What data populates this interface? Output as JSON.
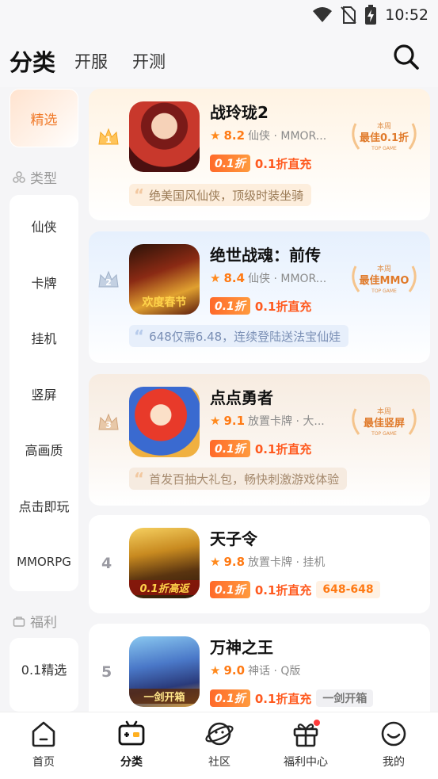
{
  "status_bar": {
    "time": "10:52"
  },
  "header": {
    "tabs": [
      {
        "label": "分类"
      },
      {
        "label": "开服"
      },
      {
        "label": "开测"
      }
    ]
  },
  "sidebar": {
    "selected": "精选",
    "type_section": {
      "title": "类型",
      "items": [
        "仙侠",
        "卡牌",
        "挂机",
        "竖屏",
        "高画质",
        "点击即玩",
        "MMORPG"
      ]
    },
    "welfare_section": {
      "title": "福利",
      "items": [
        "0.1精选"
      ]
    }
  },
  "games": [
    {
      "rank": "1",
      "title": "战玲珑2",
      "score": "8.2",
      "meta": "仙侠 · MMOR...",
      "discount_badge": "0.1折",
      "discount_text": "0.1折直充",
      "award_top": "本周",
      "award_main": "最佳0.1折",
      "award_sub": "TOP GAME",
      "slogan": "绝美国风仙侠，顶级时装坐骑"
    },
    {
      "rank": "2",
      "title": "绝世战魂：前传",
      "score": "8.4",
      "meta": "仙侠 · MMOR...",
      "discount_badge": "0.1折",
      "discount_text": "0.1折直充",
      "award_top": "本周",
      "award_main": "最佳MMO",
      "award_sub": "TOP GAME",
      "icon_caption": "欢度春节",
      "slogan": "648仅需6.48，连续登陆送法宝仙娃"
    },
    {
      "rank": "3",
      "title": "点点勇者",
      "score": "9.1",
      "meta": "放置卡牌 · 大...",
      "discount_badge": "0.1折",
      "discount_text": "0.1折直充",
      "award_top": "本周",
      "award_main": "最佳竖屏",
      "award_sub": "TOP GAME",
      "slogan": "首发百抽大礼包，畅快刺激游戏体验"
    },
    {
      "rank": "4",
      "title": "天子令",
      "score": "9.8",
      "meta": "放置卡牌 · 挂机",
      "discount_badge": "0.1折",
      "discount_text": "0.1折直充",
      "extra_tag": "648-648",
      "icon_caption": "0.1折高返"
    },
    {
      "rank": "5",
      "title": "万神之王",
      "score": "9.0",
      "meta": "神话 · Q版",
      "discount_badge": "0.1折",
      "discount_text": "0.1折直充",
      "extra_tag": "一剑开箱",
      "icon_caption": "一剑开箱"
    }
  ],
  "bottom_nav": [
    {
      "label": "首页",
      "icon": "home-icon"
    },
    {
      "label": "分类",
      "icon": "category-icon",
      "active": true
    },
    {
      "label": "社区",
      "icon": "community-icon"
    },
    {
      "label": "福利中心",
      "icon": "gift-icon",
      "dot": true
    },
    {
      "label": "我的",
      "icon": "profile-icon"
    }
  ],
  "colors": {
    "accent": "#ff7a14",
    "discount": "#ff5a1f",
    "selected_text": "#f07a2a"
  }
}
